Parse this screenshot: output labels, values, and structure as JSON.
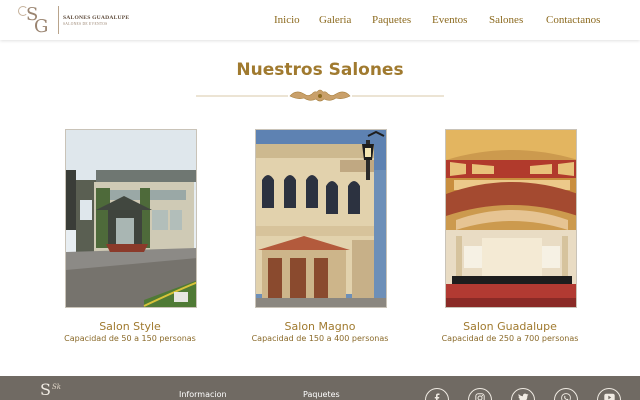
{
  "brand": {
    "name": "SALONES GUADALUPE",
    "subtitle": "SALONES DE EVENTOS",
    "monogram_s": "S",
    "monogram_g": "G"
  },
  "nav": {
    "items": [
      "Inicio",
      "Galeria",
      "Paquetes",
      "Eventos",
      "Salones",
      "Contactanos"
    ]
  },
  "section": {
    "title": "Nuestros Salones"
  },
  "salones": [
    {
      "name": "Salon Style",
      "capacity": "Capacidad de 50 a 150 personas"
    },
    {
      "name": "Salon Magno",
      "capacity": "Capacidad de 150 a 400 personas"
    },
    {
      "name": "Salon Guadalupe",
      "capacity": "Capacidad de 250 a 700 personas"
    }
  ],
  "footer": {
    "monogram": "S",
    "script": "Sk",
    "info_label": "Informacion",
    "paquetes_label": "Paquetes",
    "social_icons": [
      "facebook-icon",
      "instagram-icon",
      "twitter-icon",
      "whatsapp-icon",
      "youtube-icon"
    ]
  },
  "colors": {
    "accent": "#a07a2f",
    "nav": "#8c6a1f",
    "footer_bg": "#706a63"
  }
}
